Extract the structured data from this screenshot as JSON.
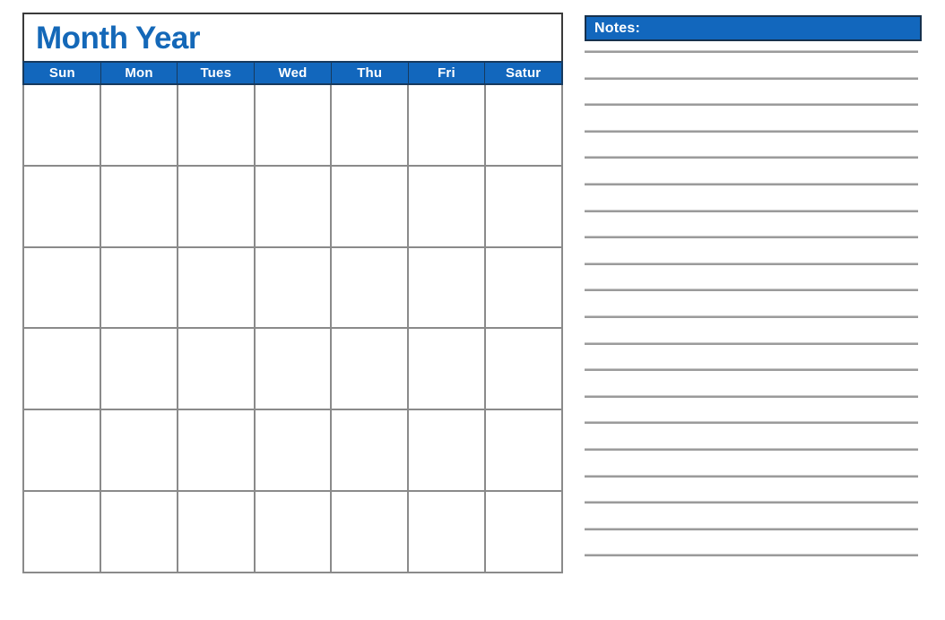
{
  "document": {
    "type": "blank-monthly-calendar-template",
    "background_color": "#ffffff"
  },
  "calendar": {
    "title": "Month Year",
    "title_color": "#1468b8",
    "header_background": "#1267bd",
    "header_text_color": "#ffffff",
    "header_border_color": "#173a5e",
    "grid_line_color": "#8a8a8a",
    "weekdays": [
      {
        "label": "Sun"
      },
      {
        "label": "Mon"
      },
      {
        "label": "Tues"
      },
      {
        "label": "Wed"
      },
      {
        "label": "Thu"
      },
      {
        "label": "Fri"
      },
      {
        "label": "Satur"
      }
    ],
    "week_count": 6,
    "day_columns": 7,
    "weeks": [
      {
        "days": [
          "",
          "",
          "",
          "",
          "",
          "",
          ""
        ]
      },
      {
        "days": [
          "",
          "",
          "",
          "",
          "",
          "",
          ""
        ]
      },
      {
        "days": [
          "",
          "",
          "",
          "",
          "",
          "",
          ""
        ]
      },
      {
        "days": [
          "",
          "",
          "",
          "",
          "",
          "",
          ""
        ]
      },
      {
        "days": [
          "",
          "",
          "",
          "",
          "",
          "",
          ""
        ]
      },
      {
        "days": [
          "",
          "",
          "",
          "",
          "",
          "",
          ""
        ]
      }
    ]
  },
  "notes": {
    "header_label": "Notes:",
    "header_background": "#1267bd",
    "header_text_color": "#ffffff",
    "header_border_color": "#17314d",
    "rule_color": "#9b9b9b",
    "line_count": 20,
    "lines": [
      "",
      "",
      "",
      "",
      "",
      "",
      "",
      "",
      "",
      "",
      "",
      "",
      "",
      "",
      "",
      "",
      "",
      "",
      "",
      ""
    ]
  }
}
